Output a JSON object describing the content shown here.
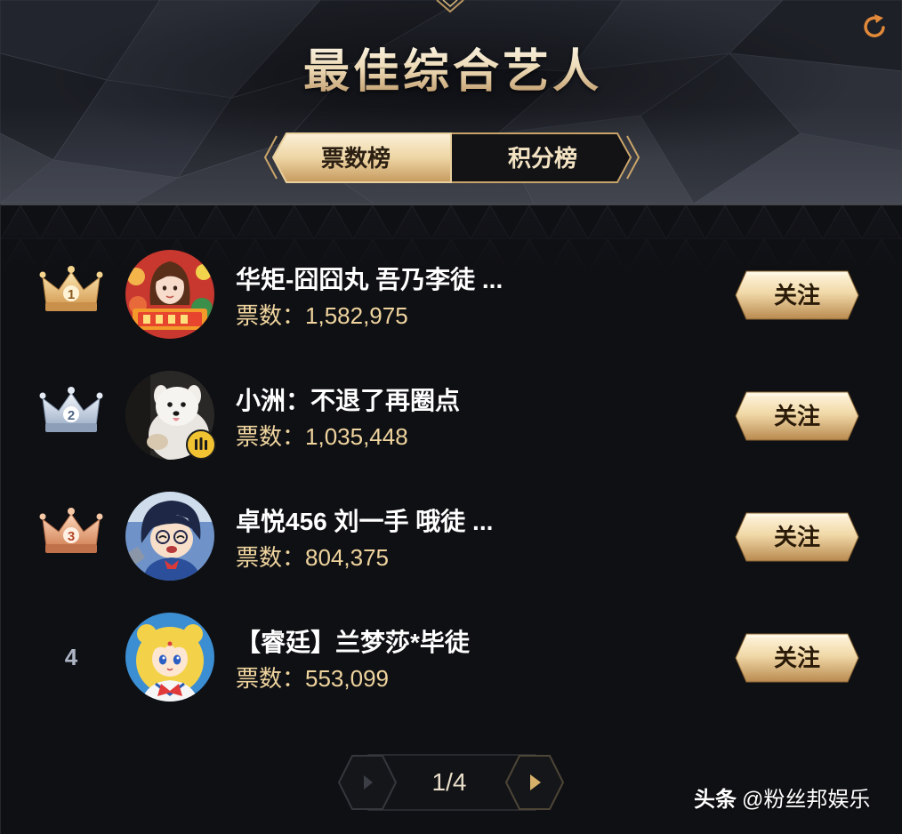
{
  "header": {
    "title": "最佳综合艺人",
    "refresh_icon": "refresh-icon",
    "ornament_icon": "diamond-ornament-icon"
  },
  "tabs": [
    {
      "label": "票数榜",
      "selected": true
    },
    {
      "label": "积分榜",
      "selected": false
    }
  ],
  "ranking": [
    {
      "rank": "1",
      "rank_icon": "gold-crown-icon",
      "name": "华矩-囧囧丸 吾乃李徒 ...",
      "votes_label": "票数：",
      "votes": "1,582,975",
      "follow_label": "关注"
    },
    {
      "rank": "2",
      "rank_icon": "silver-crown-icon",
      "badge_icon": "audio-bars-badge-icon",
      "name": "小洲：不退了再圈点",
      "votes_label": "票数：",
      "votes": "1,035,448",
      "follow_label": "关注"
    },
    {
      "rank": "3",
      "rank_icon": "bronze-crown-icon",
      "name": "卓悦456 刘一手 哦徒 ...",
      "votes_label": "票数：",
      "votes": "804,375",
      "follow_label": "关注"
    },
    {
      "rank": "4",
      "rank_icon": null,
      "name": "【睿廷】兰梦莎*毕徒",
      "votes_label": "票数：",
      "votes": "553,099",
      "follow_label": "关注"
    }
  ],
  "pagination": {
    "current": "1/4",
    "prev_icon": "prev-arrow-icon",
    "next_icon": "next-arrow-icon",
    "prev_disabled": true
  },
  "watermark": {
    "platform": "头条",
    "account": "@粉丝邦娱乐"
  },
  "colors": {
    "background": "#0e0f13",
    "gold_accent": "#c9a46a",
    "vote_text": "#efd49e",
    "refresh_orange": "#e2893a"
  }
}
